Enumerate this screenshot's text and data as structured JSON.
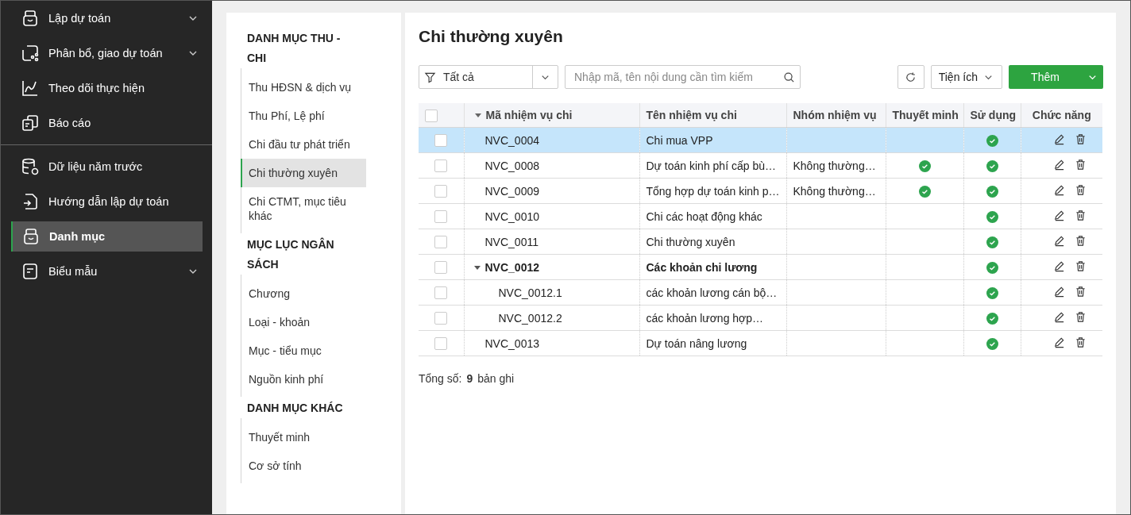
{
  "sidebar": {
    "groups": [
      [
        {
          "label": "Lập dự toán",
          "expandable": true,
          "selected": false
        },
        {
          "label": "Phân bổ, giao dự toán",
          "expandable": true,
          "selected": false
        },
        {
          "label": "Theo dõi thực hiện",
          "expandable": false,
          "selected": false
        },
        {
          "label": "Báo cáo",
          "expandable": false,
          "selected": false
        }
      ],
      [
        {
          "label": "Dữ liệu năm trước",
          "expandable": false,
          "selected": false
        },
        {
          "label": "Hướng dẫn lập dự toán",
          "expandable": false,
          "selected": false
        },
        {
          "label": "Danh mục",
          "expandable": false,
          "selected": true
        },
        {
          "label": "Biểu mẫu",
          "expandable": true,
          "selected": false
        }
      ]
    ]
  },
  "categories": [
    {
      "heading": "DANH MỤC THU - CHI",
      "items": [
        {
          "label": "Thu HĐSN & dịch vụ",
          "selected": false
        },
        {
          "label": "Thu Phí, Lệ phí",
          "selected": false
        },
        {
          "label": "Chi đầu tư phát triển",
          "selected": false
        },
        {
          "label": "Chi thường xuyên",
          "selected": true
        },
        {
          "label": "Chi CTMT, mục tiêu khác",
          "selected": false
        }
      ]
    },
    {
      "heading": "MỤC LỤC NGÂN SÁCH",
      "items": [
        {
          "label": "Chương",
          "selected": false
        },
        {
          "label": "Loại - khoản",
          "selected": false
        },
        {
          "label": "Mục - tiểu mục",
          "selected": false
        },
        {
          "label": "Nguồn kinh phí",
          "selected": false
        }
      ]
    },
    {
      "heading": "DANH MỤC KHÁC",
      "items": [
        {
          "label": "Thuyết minh",
          "selected": false
        },
        {
          "label": "Cơ sở tính",
          "selected": false
        }
      ]
    }
  ],
  "main": {
    "title": "Chi thường xuyên",
    "filter": {
      "value": "Tất cả"
    },
    "search": {
      "placeholder": "Nhập mã, tên nội dung cần tìm kiếm"
    },
    "utility_button": "Tiện ích",
    "add_button": "Thêm",
    "table": {
      "header_checked": false,
      "columns": [
        "Mã nhiệm vụ chi",
        "Tên nhiệm vụ chi",
        "Nhóm nhiệm vụ",
        "Thuyết minh",
        "Sử dụng",
        "Chức năng"
      ],
      "rows": [
        {
          "code": "NVC_0004",
          "name": "Chi mua VPP",
          "explained": false,
          "in_use": true,
          "checked": false,
          "selected": true
        },
        {
          "code": "NVC_0008",
          "name": "Dự toán kinh phí cấp bù…",
          "group": "Không thường…",
          "explained": true,
          "in_use": true,
          "checked": false,
          "selected": false
        },
        {
          "code": "NVC_0009",
          "name": "Tổng hợp dự toán kinh p…",
          "group": "Không thường…",
          "explained": true,
          "in_use": true,
          "checked": false,
          "selected": false
        },
        {
          "code": "NVC_0010",
          "name": "Chi các hoạt động khác",
          "explained": false,
          "in_use": true,
          "checked": false,
          "selected": false
        },
        {
          "code": "NVC_0011",
          "name": "Chi thường xuyên",
          "explained": false,
          "in_use": true,
          "checked": false,
          "selected": false
        },
        {
          "code": "NVC_0012",
          "name": "Các khoản chi lương",
          "explained": false,
          "in_use": true,
          "checked": false,
          "selected": false,
          "expanded": true,
          "children": [
            {
              "code": "NVC_0012.1",
              "name": "các khoản lương cán bộ…",
              "explained": false,
              "in_use": true,
              "checked": false,
              "selected": false
            },
            {
              "code": "NVC_0012.2",
              "name": "các khoản lương hợp…",
              "explained": false,
              "in_use": true,
              "checked": false,
              "selected": false
            }
          ]
        },
        {
          "code": "NVC_0013",
          "name": "Dự toán nâng lương",
          "explained": false,
          "in_use": true,
          "checked": false,
          "selected": false
        }
      ]
    },
    "total": {
      "label": "Tổng số:",
      "count": "9",
      "unit": "bản ghi"
    }
  }
}
